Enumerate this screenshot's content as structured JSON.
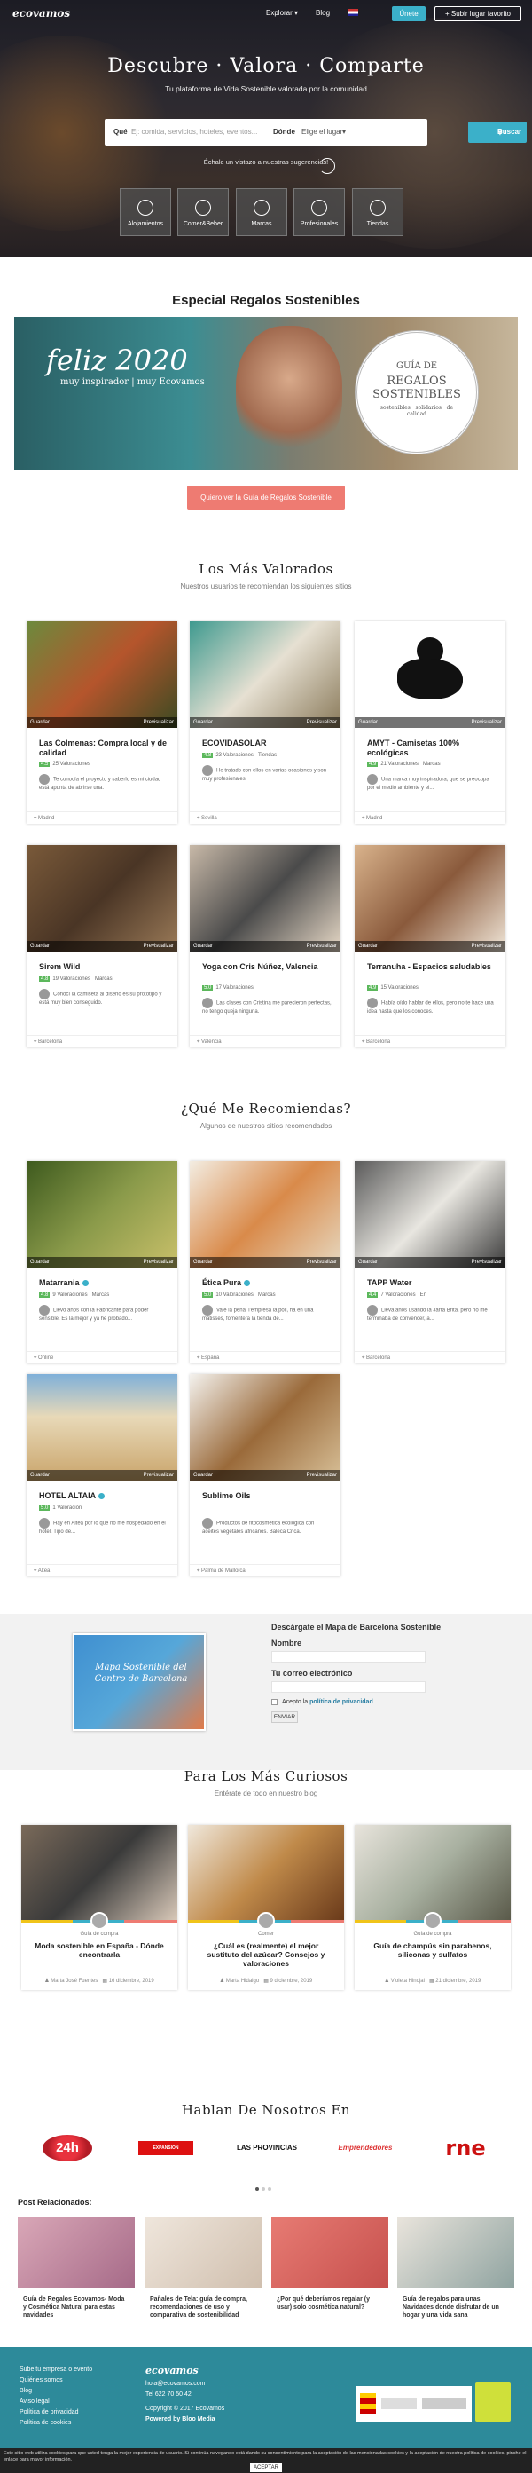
{
  "header": {
    "logo": "ecovamos",
    "nav": [
      "Explorar ▾",
      "Blog"
    ],
    "login": "Únete",
    "add_place": "+ Subir lugar favorito"
  },
  "hero": {
    "title": "Descubre · Valora · Comparte",
    "subtitle": "Tu plataforma de Vida Sostenible valorada por la comunidad",
    "search_label": "Qué",
    "search_placeholder": "Ej: comida, servicios, hoteles, eventos...",
    "where_label": "Dónde",
    "where_placeholder": "Elige el lugar",
    "search_button": "Buscar",
    "hint": "Échale un vistazo a nuestras sugerencias!",
    "categories": [
      "Alojamientos",
      "Comer&Beber",
      "Marcas",
      "Profesionales",
      "Tiendas"
    ]
  },
  "gifts": {
    "title": "Especial Regalos Sostenibles",
    "banner_title": "feliz 2020",
    "banner_sub": "muy inspirador | muy Ecovamos",
    "guide_top": "GUÍA DE",
    "guide_main": "REGALOS SOSTENIBLES",
    "guide_bottom": "sostenibles · solidarios · de calidad",
    "button": "Quiero ver la Guía de Regalos Sostenible"
  },
  "top_rated": {
    "title": "Los Más Valorados",
    "subtitle": "Nuestros usuarios te recomiendan los siguientes sitios",
    "cards": [
      {
        "title": "Las Colmenas: Compra local y de calidad",
        "rating": "4.5",
        "count": "25 Valoraciones",
        "type": "",
        "desc": "Te conocía el proyecto y saberlo es mi ciudad está apunta de abrirse una.",
        "loc": "Madrid",
        "guardar": "Guardar",
        "prev": "Previsualizar"
      },
      {
        "title": "ECOVIDASOLAR",
        "rating": "4.8",
        "count": "23 Valoraciones",
        "type": "Tiendas",
        "desc": "He tratado con ellos en varias ocasiones y son muy profesionales.",
        "loc": "Sevilla",
        "guardar": "Guardar",
        "prev": "Previsualizar"
      },
      {
        "title": "AMYT - Camisetas 100% ecológicas",
        "rating": "4.9",
        "count": "21 Valoraciones",
        "type": "Marcas",
        "desc": "Una marca muy inspiradora, que se preocupa por el medio ambiente y el...",
        "loc": "Madrid",
        "guardar": "Guardar",
        "prev": "Previsualizar"
      },
      {
        "title": "Sirem Wild",
        "rating": "4.8",
        "count": "19 Valoraciones",
        "type": "Marcas",
        "desc": "Conocí la camiseta al diseño es su prototipo y está muy bien conseguido.",
        "loc": "Barcelona",
        "guardar": "Guardar",
        "prev": "Previsualizar"
      },
      {
        "title": "Yoga con Cris Núñez, Valencia",
        "rating": "5.0",
        "count": "17 Valoraciones",
        "type": "",
        "desc": "Las clases con Cristina me parecieron perfectas, no tengo queja ninguna.",
        "loc": "Valencia",
        "guardar": "Guardar",
        "prev": "Previsualizar"
      },
      {
        "title": "Terranuha - Espacios saludables",
        "rating": "4.9",
        "count": "15 Valoraciones",
        "type": "",
        "desc": "Había oído hablar de ellos, pero no te hace una idea hasta que los conoces.",
        "loc": "Barcelona",
        "guardar": "Guardar",
        "prev": "Previsualizar"
      }
    ]
  },
  "recommend": {
    "title": "¿Qué Me Recomiendas?",
    "subtitle": "Algunos de nuestros sitios recomendados",
    "cards": [
      {
        "title": "Matarrania",
        "rating": "4.8",
        "count": "9 Valoraciones",
        "type": "Marcas",
        "desc": "Llevo años con la Fabricante para poder sensible. Es la mejor y ya he probado...",
        "loc": "Online",
        "guardar": "Guardar",
        "prev": "Previsualizar"
      },
      {
        "title": "Ética Pura",
        "rating": "5.0",
        "count": "10 Valoraciones",
        "type": "Marcas",
        "desc": "Vale la pena, l'empresa la poli, ha en una matisses, fomentera la tienda de...",
        "loc": "España",
        "guardar": "Guardar",
        "prev": "Previsualizar"
      },
      {
        "title": "TAPP Water",
        "rating": "4.4",
        "count": "7 Valoraciones",
        "type": "En",
        "desc": "Lleva años usando la Jarra Brita, pero no me terminaba de convencer, a...",
        "loc": "Barcelona",
        "guardar": "Guardar",
        "prev": "Previsualizar"
      },
      {
        "title": "HOTEL ALTAIA",
        "rating": "5.0",
        "count": "1 Valoración",
        "type": "",
        "desc": "Hay en Altea por lo que no me hospedado en el hotel. Tipo de...",
        "loc": "Altea",
        "guardar": "Guardar",
        "prev": "Previsualizar"
      },
      {
        "title": "Sublime Oils",
        "rating": "",
        "count": "",
        "type": "",
        "desc": "Productos de fitocosmética ecológica con aceites vegetales africanos. Baleca Crica.",
        "loc": "Palma de Mallorca",
        "guardar": "Guardar",
        "prev": "Previsualizar"
      }
    ]
  },
  "newsletter": {
    "map_title": "Mapa Sostenible del Centro de Barcelona",
    "heading": "Descárgate el Mapa de Barcelona Sostenible",
    "name_label": "Nombre",
    "email_label": "Tu correo electrónico",
    "accept": "Acepto la",
    "privacy": "política de privacidad",
    "submit": "ENVIAR"
  },
  "blog": {
    "title": "Para Los Más Curiosos",
    "subtitle": "Entérate de todo en nuestro blog",
    "posts": [
      {
        "category": "Guía de compra",
        "title": "Moda sostenible en España - Dónde encontrarla",
        "author": "Marta José Fuentes",
        "date": "16 diciembre, 2019"
      },
      {
        "category": "Comer",
        "title": "¿Cuál es (realmente) el mejor sustituto del azúcar? Consejos y valoraciones",
        "author": "Marta Hidalgo",
        "date": "9 diciembre, 2019"
      },
      {
        "category": "Guía de compra",
        "title": "Guía de champús sin parabenos, siliconas y sulfatos",
        "author": "Violeta Hinojal",
        "date": "21 diciembre, 2019"
      }
    ]
  },
  "press": {
    "title": "Hablan De Nosotros En",
    "logos": [
      "24h",
      "EXPANSION",
      "LAS PROVINCIAS",
      "Emprendedores",
      "rne"
    ]
  },
  "related": {
    "title": "Post Relacionados:",
    "posts": [
      "Guía de Regalos Ecovamos- Moda y Cosmética Natural para estas navidades",
      "Pañales de Tela: guía de compra, recomendaciones de uso y comparativa de sostenibilidad",
      "¿Por qué deberíamos regalar (y usar) solo cosmética natural?",
      "Guía de regalos para unas Navidades donde disfrutar de un hogar y una vida sana"
    ]
  },
  "footer": {
    "links": [
      "Sube tu empresa o evento",
      "Quiénes somos",
      "Blog",
      "Aviso legal",
      "Política de privacidad",
      "Política de cookies"
    ],
    "logo": "ecovamos",
    "email": "hola@ecovamos.com",
    "phone": "Tel 622 70 50 42",
    "copyright": "Copyright © 2017 Ecovamos",
    "powered": "Powered by Bloo Media",
    "cookie_text": "Este sitio web utiliza cookies para que usted tenga la mejor experiencia de usuario. Si continúa navegando está dando su consentimiento para la aceptación de las mencionadas cookies y la aceptación de nuestra política de cookies, pinche el enlace para mayor información.",
    "cookie_accept": "ACEPTAR"
  },
  "colors": {
    "accent": "#3bb0c9",
    "coral": "#ee7b72",
    "footer": "#2d8a9a",
    "rating": "#5cb85c"
  }
}
